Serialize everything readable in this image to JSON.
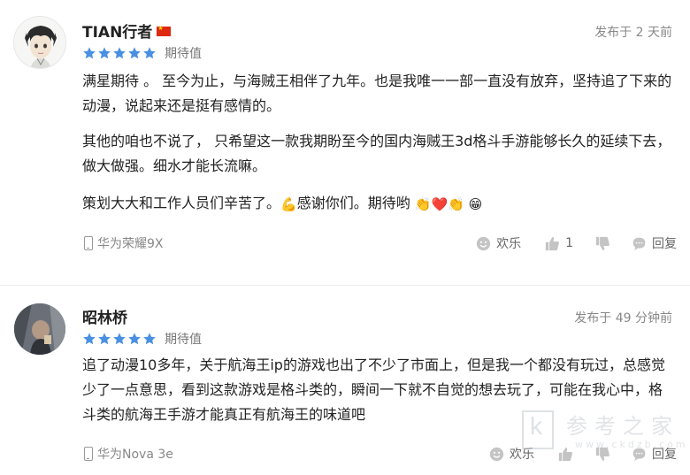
{
  "colors": {
    "star": "#4a90e2",
    "flag": "#de2910",
    "icon_gray": "#bdbdbd"
  },
  "reviews": [
    {
      "username": "TIAN行者",
      "flag": "China flag",
      "time": "发布于 2 天前",
      "stars": 5,
      "rating_label": "期待值",
      "paragraphs": [
        "满星期待 。 至今为止，与海贼王相伴了九年。也是我唯一一部一直没有放弃，坚持追了下来的动漫，说起来还是挺有感情的。",
        "其他的咱也不说了， 只希望这一款我期盼至今的国内海贼王3d格斗手游能够长久的延续下去，做大做强。细水才能长流嘛。"
      ],
      "para3_text": "策划大大和工作人员们辛苦了。",
      "para3_emoji_muscle": "💪",
      "para3_text2": "感谢你们。期待哟 ",
      "para3_emoji_tail": "👏❤️👏 😁",
      "device": "华为荣耀9X",
      "actions": {
        "fun": "欢乐",
        "like_count": "1",
        "reply": "回复"
      }
    },
    {
      "username": "昭林桥",
      "time": "发布于 49 分钟前",
      "stars": 5,
      "rating_label": "期待值",
      "paragraphs": [
        "追了动漫10多年，关于航海王ip的游戏也出了不少了市面上，但是我一个都没有玩过，总感觉少了一点意思，看到这款游戏是格斗类的，瞬间一下就不自觉的想去玩了，可能在我心中，格斗类的航海王手游才能真正有航海王的味道吧"
      ],
      "device": "华为Nova 3e",
      "actions": {
        "fun": "欢乐",
        "reply": "回复"
      }
    }
  ],
  "watermark": {
    "letter": "k",
    "chinese": "参考之家",
    "url": "www.ckdzb.com"
  }
}
